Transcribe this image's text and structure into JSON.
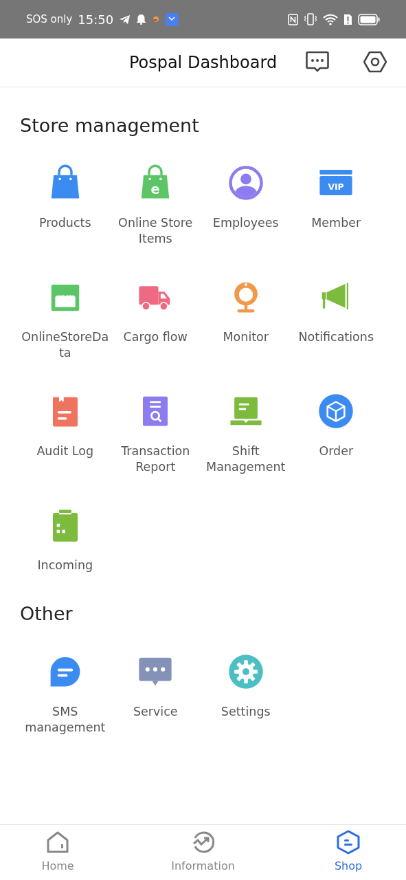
{
  "status_bar": {
    "carrier": "SOS only",
    "time": "15:50"
  },
  "header": {
    "title": "Pospal Dashboard"
  },
  "sections": [
    {
      "title": "Store management",
      "items": [
        {
          "label": "Products",
          "kind": "bag",
          "color": "#3b8bf0"
        },
        {
          "label": "Online Store Items",
          "kind": "e-bag",
          "color": "#5cc565",
          "glyph": "e"
        },
        {
          "label": "Employees",
          "kind": "person",
          "color": "#8c7cf0"
        },
        {
          "label": "Member",
          "kind": "vip",
          "color": "#3b8bf0",
          "glyph": "VIP"
        },
        {
          "label": "OnlineStoreData",
          "kind": "store",
          "color": "#5cc565"
        },
        {
          "label": "Cargo flow",
          "kind": "truck",
          "color": "#ee6a82"
        },
        {
          "label": "Monitor",
          "kind": "webcam",
          "color": "#f0994a"
        },
        {
          "label": "Notifications",
          "kind": "megaphone",
          "color": "#7cbb3e"
        },
        {
          "label": "Audit Log",
          "kind": "doc",
          "color": "#ef7460"
        },
        {
          "label": "Transaction Report",
          "kind": "report",
          "color": "#8c7cf0"
        },
        {
          "label": "Shift Management",
          "kind": "laptop",
          "color": "#7cbb3e"
        },
        {
          "label": "Order",
          "kind": "cube",
          "color": "#3b8bf0"
        },
        {
          "label": "Incoming",
          "kind": "clipboard",
          "color": "#7cbb3e"
        }
      ]
    },
    {
      "title": "Other",
      "items": [
        {
          "label": "SMS management",
          "kind": "chat",
          "color": "#3b8bf0"
        },
        {
          "label": "Service",
          "kind": "service",
          "color": "#8492b8"
        },
        {
          "label": "Settings",
          "kind": "gear",
          "color": "#4cbfc4"
        }
      ]
    }
  ],
  "tab_bar": [
    {
      "label": "Home",
      "kind": "home",
      "selected": false
    },
    {
      "label": "Information",
      "kind": "trend",
      "selected": false
    },
    {
      "label": "Shop",
      "kind": "shop",
      "selected": true
    }
  ]
}
